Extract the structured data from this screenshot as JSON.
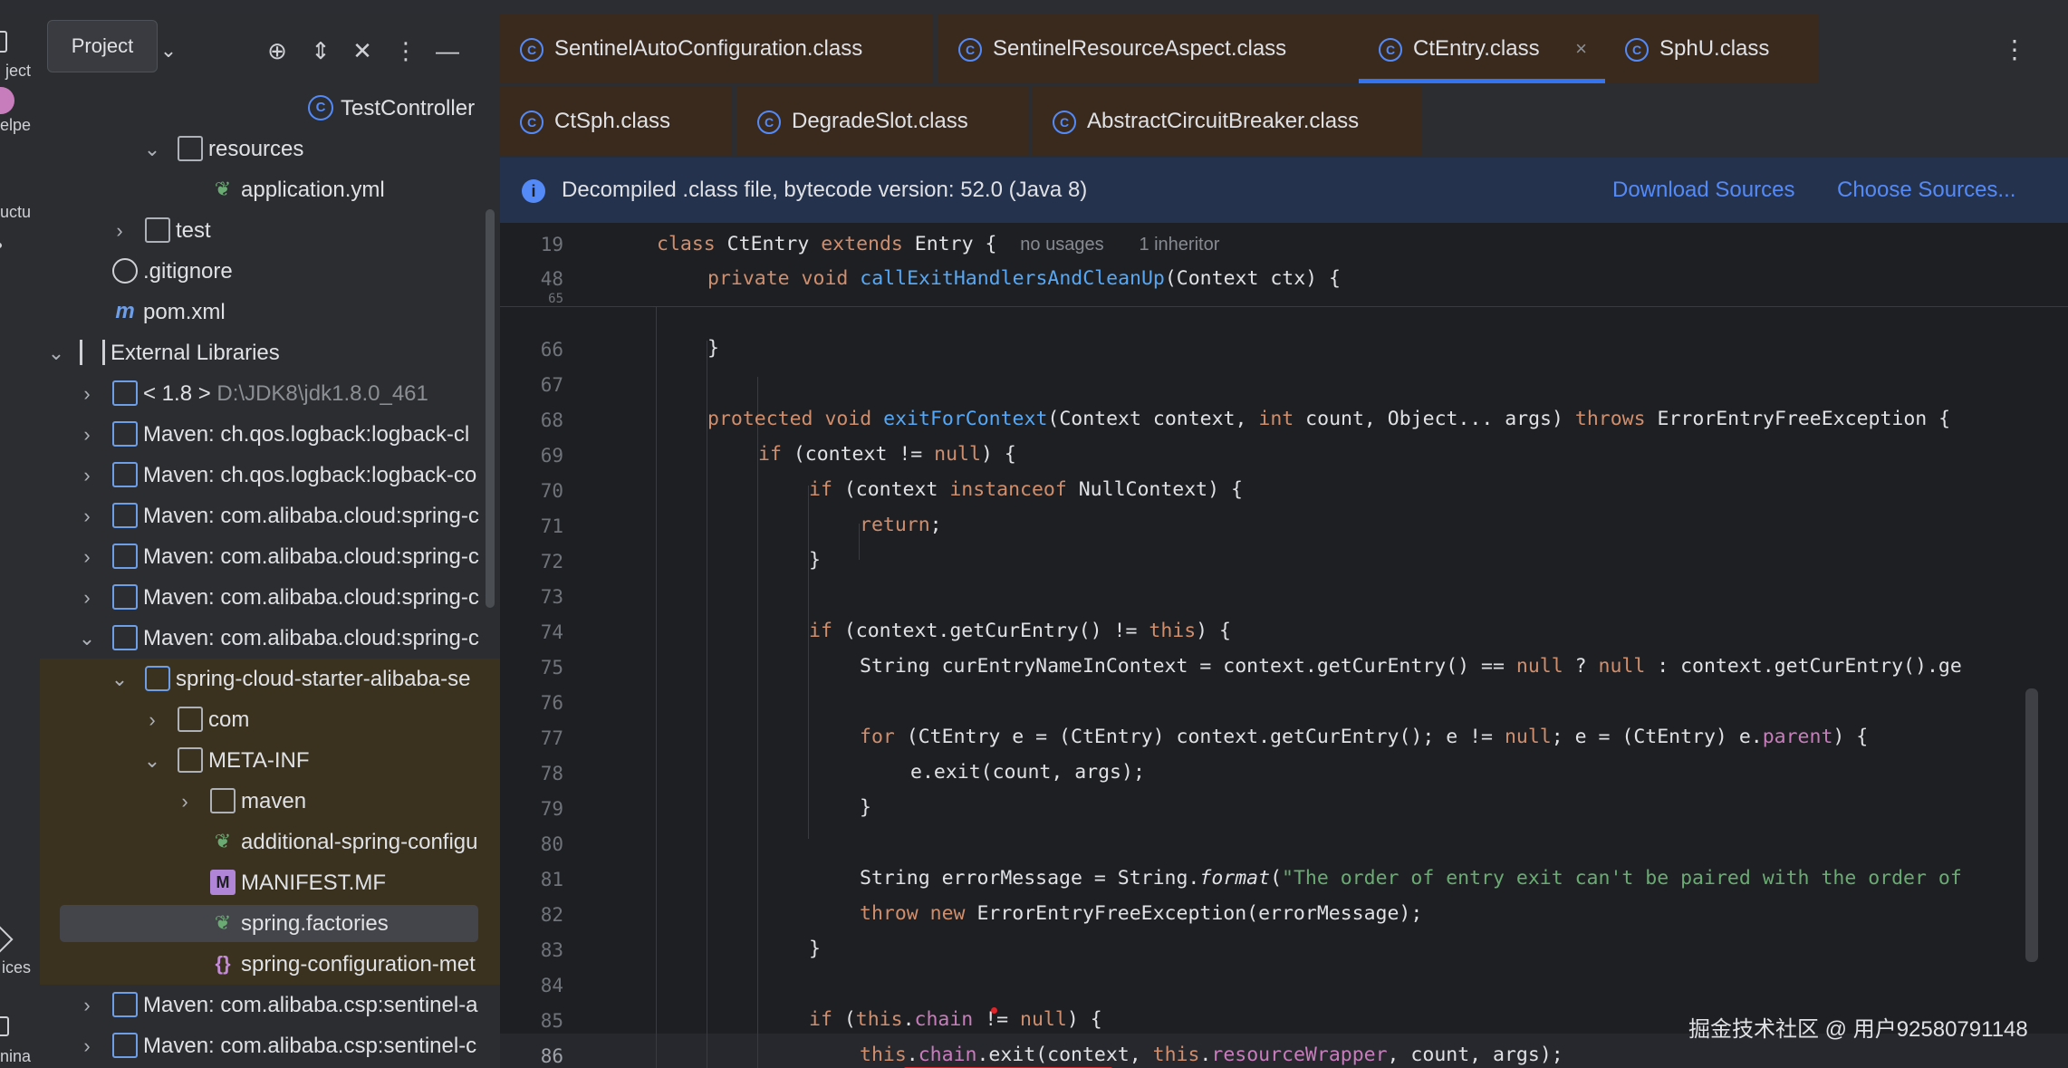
{
  "tooltip": "Project",
  "activity_bar": [
    {
      "label": "ject",
      "icon": "folder-icon"
    },
    {
      "label": "elpe",
      "icon": "avatar-icon"
    },
    {
      "label": "uctu",
      "icon": "structure-icon"
    },
    {
      "label": "ices",
      "icon": "services-icon"
    },
    {
      "label": "nina",
      "icon": "terminal-icon"
    }
  ],
  "project_tree": [
    {
      "label": "TestController",
      "icon": "class-icon"
    },
    {
      "label": "resources",
      "icon": "folder-icon"
    },
    {
      "label": "application.yml",
      "icon": "yaml-icon"
    },
    {
      "label": "test",
      "icon": "folder-icon"
    },
    {
      "label": ".gitignore",
      "icon": "ignore-icon"
    },
    {
      "label": "pom.xml",
      "icon": "maven-icon"
    },
    {
      "label": "External Libraries",
      "icon": "library-icon"
    },
    {
      "label": "< 1.8 >",
      "extra": "D:\\JDK8\\jdk1.8.0_461",
      "icon": "jdk-icon"
    },
    {
      "label": "Maven: ch.qos.logback:logback-cl",
      "icon": "library-icon"
    },
    {
      "label": "Maven: ch.qos.logback:logback-co",
      "icon": "library-icon"
    },
    {
      "label": "Maven: com.alibaba.cloud:spring-c",
      "icon": "library-icon"
    },
    {
      "label": "Maven: com.alibaba.cloud:spring-c",
      "icon": "library-icon"
    },
    {
      "label": "Maven: com.alibaba.cloud:spring-c",
      "icon": "library-icon"
    },
    {
      "label": "Maven: com.alibaba.cloud:spring-c",
      "icon": "library-icon"
    },
    {
      "label": "spring-cloud-starter-alibaba-se",
      "icon": "archive-icon"
    },
    {
      "label": "com",
      "icon": "folder-icon"
    },
    {
      "label": "META-INF",
      "icon": "folder-icon"
    },
    {
      "label": "maven",
      "icon": "folder-icon"
    },
    {
      "label": "additional-spring-configu",
      "icon": "spring-config-icon"
    },
    {
      "label": "MANIFEST.MF",
      "icon": "manifest-icon"
    },
    {
      "label": "spring.factories",
      "icon": "spring-factories-icon"
    },
    {
      "label": "spring-configuration-met",
      "icon": "json-icon"
    },
    {
      "label": "Maven: com.alibaba.csp:sentinel-a",
      "icon": "library-icon"
    },
    {
      "label": "Maven: com.alibaba.csp:sentinel-c",
      "icon": "library-icon"
    }
  ],
  "tabs_row1": [
    "SentinelAutoConfiguration.class",
    "SentinelResourceAspect.class",
    "CtEntry.class",
    "SphU.class"
  ],
  "tabs_row2": [
    "CtSph.class",
    "DegradeSlot.class",
    "AbstractCircuitBreaker.class"
  ],
  "active_tab": "CtEntry.class",
  "tab_close": "×",
  "more_menu": "⋮",
  "banner": {
    "message": "Decompiled .class file, bytecode version: 52.0 (Java 8)",
    "download": "Download Sources",
    "choose": "Choose Sources..."
  },
  "sticky": [
    {
      "ln": "19",
      "code": "class CtEntry extends Entry {",
      "hint1": "no usages",
      "hint2": "1 inheritor"
    },
    {
      "ln": "48",
      "code": "    private void callExitHandlersAndCleanUp(Context ctx) {"
    },
    {
      "ln": "65"
    }
  ],
  "code_lines": [
    {
      "ln": "66",
      "code": "    }"
    },
    {
      "ln": "67",
      "code": ""
    },
    {
      "ln": "68",
      "code": "    protected void exitForContext(Context context, int count, Object... args) throws ErrorEntryFreeException {"
    },
    {
      "ln": "69",
      "code": "        if (context != null) {"
    },
    {
      "ln": "70",
      "code": "            if (context instanceof NullContext) {"
    },
    {
      "ln": "71",
      "code": "                return;"
    },
    {
      "ln": "72",
      "code": "            }"
    },
    {
      "ln": "73",
      "code": ""
    },
    {
      "ln": "74",
      "code": "            if (context.getCurEntry() != this) {"
    },
    {
      "ln": "75",
      "code": "                String curEntryNameInContext = context.getCurEntry() == null ? null : context.getCurEntry().ge"
    },
    {
      "ln": "76",
      "code": ""
    },
    {
      "ln": "77",
      "code": "                for (CtEntry e = (CtEntry) context.getCurEntry(); e != null; e = (CtEntry) e.parent) {"
    },
    {
      "ln": "78",
      "code": "                    e.exit(count, args);"
    },
    {
      "ln": "79",
      "code": "                }"
    },
    {
      "ln": "80",
      "code": ""
    },
    {
      "ln": "81",
      "code": "                String errorMessage = String.format(\"The order of entry exit can't be paired with the order of"
    },
    {
      "ln": "82",
      "code": "                throw new ErrorEntryFreeException(errorMessage);"
    },
    {
      "ln": "83",
      "code": "            }"
    },
    {
      "ln": "84",
      "code": ""
    },
    {
      "ln": "85",
      "code": "            if (this.chain != null) {"
    },
    {
      "ln": "86",
      "code": "                this.chain.exit(context, this.resourceWrapper, count, args);"
    }
  ],
  "watermark": "掘金技术社区 @ 用户92580791148",
  "colors": {
    "keyword": "#cf8e6d",
    "method": "#56a8f5",
    "field": "#c77dbb",
    "string": "#6aab73",
    "accent": "#3574f0",
    "annotation_red": "#e0242a"
  }
}
